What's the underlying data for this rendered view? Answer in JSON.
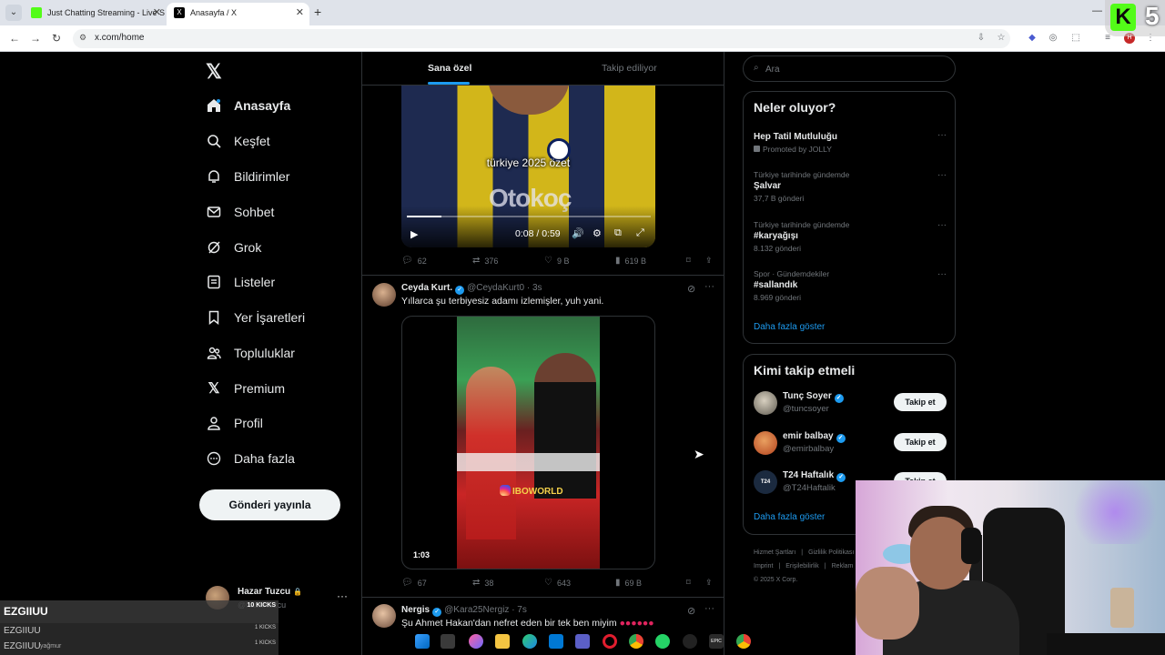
{
  "browser": {
    "tabs": [
      {
        "title": "Just Chatting Streaming - Live S",
        "active": false,
        "favicon_color": "#53fc18"
      },
      {
        "title": "Anasayfa / X",
        "active": true,
        "favicon_color": "#000000"
      }
    ],
    "new_tab": "+",
    "url": "x.com/home",
    "window_controls": {
      "minimize": "—",
      "maximize": "□",
      "close": "✕"
    }
  },
  "x": {
    "logo": "𝕏",
    "nav": [
      {
        "label": "Anasayfa",
        "icon": "home-icon",
        "active": true
      },
      {
        "label": "Keşfet",
        "icon": "search-icon"
      },
      {
        "label": "Bildirimler",
        "icon": "bell-icon"
      },
      {
        "label": "Sohbet",
        "icon": "mail-icon"
      },
      {
        "label": "Grok",
        "icon": "grok-icon"
      },
      {
        "label": "Listeler",
        "icon": "list-icon"
      },
      {
        "label": "Yer İşaretleri",
        "icon": "bookmark-icon"
      },
      {
        "label": "Topluluklar",
        "icon": "communities-icon"
      },
      {
        "label": "Premium",
        "icon": "x-icon"
      },
      {
        "label": "Profil",
        "icon": "profile-icon"
      },
      {
        "label": "Daha fazla",
        "icon": "more-circle-icon"
      }
    ],
    "post_button": "Gönderi yayınla",
    "account": {
      "name": "Hazar Tuzcu",
      "lock": "🔒",
      "handle": "@hazartuzcu",
      "more": "···"
    }
  },
  "feed": {
    "tabs": [
      "Sana özel",
      "Takip ediliyor"
    ],
    "post1": {
      "video_caption": "türkiye 2025 özet",
      "sponsor_text": "Otokoç",
      "time": "0:08 / 0:59",
      "progress": 0.14,
      "stats": {
        "replies": "62",
        "reposts": "376",
        "likes": "9 B",
        "views": "619 B"
      }
    },
    "post2": {
      "name": "Ceyda Kurt.",
      "handle": "@CeydaKurt0",
      "time": "· 3s",
      "text": "Yıllarca şu terbiyesiz adamı izlemişler, yuh yani.",
      "video_tag": "IBOWORLD",
      "duration": "1:03",
      "stats": {
        "replies": "67",
        "reposts": "38",
        "likes": "643",
        "views": "69 B"
      }
    },
    "post3": {
      "name": "Nergis",
      "handle": "@Kara25Nergiz",
      "time": "· 7s",
      "text": "Şu Ahmet Hakan'dan nefret eden bir tek ben miyim"
    }
  },
  "sidebar": {
    "search_placeholder": "Ara",
    "trends_title": "Neler oluyor?",
    "trends": [
      {
        "context": "",
        "title": "Hep Tatil Mutluluğu",
        "count": "Promoted by JOLLY"
      },
      {
        "context": "Türkiye tarihinde gündemde",
        "title": "Şalvar",
        "count": "37,7 B gönderi"
      },
      {
        "context": "Türkiye tarihinde gündemde",
        "title": "#karyağışı",
        "count": "8.132 gönderi"
      },
      {
        "context": "Spor · Gündemdekiler",
        "title": "#sallandık",
        "count": "8.969 gönderi"
      }
    ],
    "show_more": "Daha fazla göster",
    "who_title": "Kimi takip etmeli",
    "who": [
      {
        "name": "Tunç Soyer",
        "handle": "@tuncsoyer",
        "button": "Takip et"
      },
      {
        "name": "emir balbay",
        "handle": "@emirbalbay",
        "button": "Takip et"
      },
      {
        "name": "T24 Haftalık",
        "handle": "@T24Haftalik",
        "button": "Takip et"
      }
    ],
    "who_show_more": "Daha fazla göster",
    "footer": {
      "line1": [
        "Hizmet Şartları",
        "|",
        "Gizlilik Politikası"
      ],
      "line2": [
        "Imprint",
        "|",
        "Erişilebilirlik",
        "|",
        "Reklam"
      ],
      "line3": "© 2025 X Corp."
    }
  },
  "overlay": {
    "kick_letter": "K",
    "kick_number": "5",
    "kicks": [
      {
        "name": "EZGIIUU",
        "value": "10 KICKS"
      },
      {
        "name": "EZGIIUU",
        "value": "1 KICKS"
      },
      {
        "name": "EZGIIUU",
        "value": "1 KICKS"
      }
    ],
    "kick_sub": "yağmur"
  }
}
